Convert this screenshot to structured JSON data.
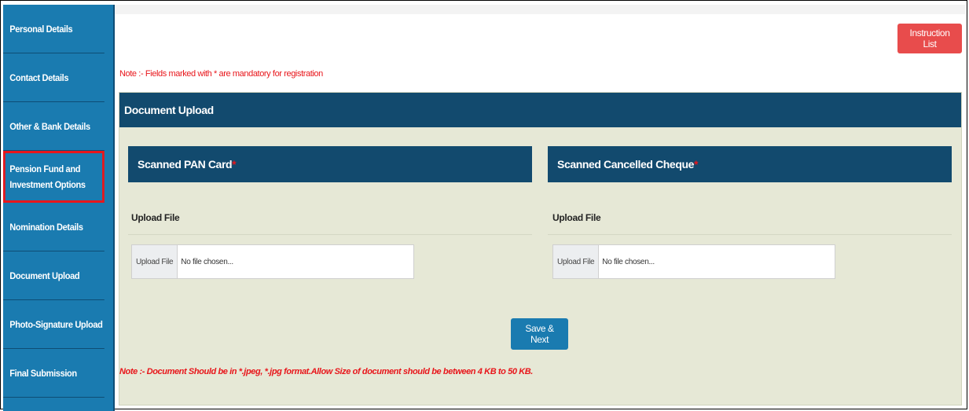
{
  "sidebar": {
    "items": [
      {
        "label": "Personal Details"
      },
      {
        "label": "Contact Details"
      },
      {
        "label": "Other & Bank Details"
      },
      {
        "label": "Pension Fund and Investment Options"
      },
      {
        "label": "Nomination Details"
      },
      {
        "label": "Document Upload"
      },
      {
        "label": "Photo-Signature Upload"
      },
      {
        "label": "Final Submission"
      }
    ]
  },
  "header": {
    "instruction_button": "Instruction List",
    "note": "Note :- Fields marked with * are mandatory for registration"
  },
  "panel": {
    "title": "Document Upload",
    "sections": [
      {
        "title": "Scanned PAN Card",
        "required_mark": "*",
        "upload_label": "Upload File",
        "file_button": "Upload File",
        "file_placeholder": "No file chosen..."
      },
      {
        "title": "Scanned Cancelled Cheque",
        "required_mark": "*",
        "upload_label": "Upload File",
        "file_button": "Upload File",
        "file_placeholder": "No file chosen..."
      }
    ],
    "save_button": "Save & Next",
    "note": "Note :- Document Should be in *.jpeg, *.jpg format.Allow Size of document should be between 4 KB to 50 KB."
  },
  "colors": {
    "sidebar": "#1a7bb0",
    "header": "#124a6e",
    "panel": "#e6e8d6",
    "accent_red": "#e8161b",
    "instruction_button": "#e84c4c"
  }
}
